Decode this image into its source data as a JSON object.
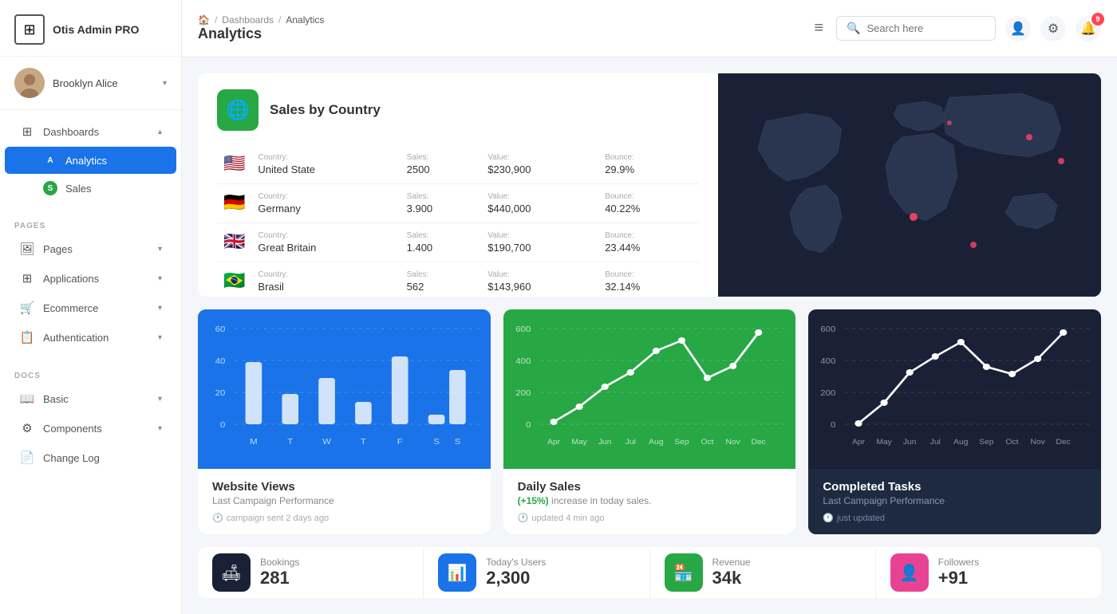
{
  "app": {
    "name": "Otis Admin PRO"
  },
  "user": {
    "name": "Brooklyn Alice"
  },
  "breadcrumb": {
    "home": "🏠",
    "dashboards": "Dashboards",
    "current": "Analytics",
    "page_title": "Analytics"
  },
  "header": {
    "search_placeholder": "Search here",
    "hamburger": "≡",
    "notification_count": "9"
  },
  "sidebar": {
    "nav_sections": [
      {
        "label": "",
        "items": [
          {
            "id": "dashboards",
            "icon": "⊞",
            "label": "Dashboards",
            "active": false,
            "has_chevron": true
          },
          {
            "id": "analytics",
            "icon": "A",
            "label": "Analytics",
            "active": true,
            "is_sub": true
          },
          {
            "id": "sales",
            "icon": "S",
            "label": "Sales",
            "active": false,
            "is_sub": true
          }
        ]
      },
      {
        "label": "PAGES",
        "items": [
          {
            "id": "pages",
            "icon": "🖼",
            "label": "Pages",
            "has_chevron": true
          },
          {
            "id": "applications",
            "icon": "⊞",
            "label": "Applications",
            "has_chevron": true
          },
          {
            "id": "ecommerce",
            "icon": "🛒",
            "label": "Ecommerce",
            "has_chevron": true
          },
          {
            "id": "authentication",
            "icon": "📋",
            "label": "Authentication",
            "has_chevron": true
          }
        ]
      },
      {
        "label": "DOCS",
        "items": [
          {
            "id": "basic",
            "icon": "📖",
            "label": "Basic",
            "has_chevron": true
          },
          {
            "id": "components",
            "icon": "⚙",
            "label": "Components",
            "has_chevron": true
          },
          {
            "id": "changelog",
            "icon": "📄",
            "label": "Change Log"
          }
        ]
      }
    ]
  },
  "sales_by_country": {
    "title": "Sales by Country",
    "rows": [
      {
        "flag": "🇺🇸",
        "country_label": "Country:",
        "country": "United State",
        "sales_label": "Sales:",
        "sales": "2500",
        "value_label": "Value:",
        "value": "$230,900",
        "bounce_label": "Bounce:",
        "bounce": "29.9%"
      },
      {
        "flag": "🇩🇪",
        "country_label": "Country:",
        "country": "Germany",
        "sales_label": "Sales:",
        "sales": "3.900",
        "value_label": "Value:",
        "value": "$440,000",
        "bounce_label": "Bounce:",
        "bounce": "40.22%"
      },
      {
        "flag": "🇬🇧",
        "country_label": "Country:",
        "country": "Great Britain",
        "sales_label": "Sales:",
        "sales": "1.400",
        "value_label": "Value:",
        "value": "$190,700",
        "bounce_label": "Bounce:",
        "bounce": "23.44%"
      },
      {
        "flag": "🇧🇷",
        "country_label": "Country:",
        "country": "Brasil",
        "sales_label": "Sales:",
        "sales": "562",
        "value_label": "Value:",
        "value": "$143,960",
        "bounce_label": "Bounce:",
        "bounce": "32.14%"
      }
    ]
  },
  "charts": {
    "website_views": {
      "title": "Website Views",
      "subtitle": "Last Campaign Performance",
      "footer": "campaign sent 2 days ago",
      "y_labels": [
        "60",
        "40",
        "20",
        "0"
      ],
      "x_labels": [
        "M",
        "T",
        "W",
        "T",
        "F",
        "S",
        "S"
      ],
      "bars": [
        45,
        25,
        35,
        20,
        50,
        10,
        40
      ]
    },
    "daily_sales": {
      "title": "Daily Sales",
      "subtitle_prefix": "(+15%)",
      "subtitle_suffix": " increase in today sales.",
      "footer": "updated 4 min ago",
      "y_labels": [
        "600",
        "400",
        "200",
        "0"
      ],
      "x_labels": [
        "Apr",
        "May",
        "Jun",
        "Jul",
        "Aug",
        "Sep",
        "Oct",
        "Nov",
        "Dec"
      ],
      "points": [
        10,
        80,
        220,
        300,
        420,
        480,
        280,
        350,
        520
      ]
    },
    "completed_tasks": {
      "title": "Completed Tasks",
      "subtitle": "Last Campaign Performance",
      "footer": "just updated",
      "y_labels": [
        "600",
        "400",
        "200",
        "0"
      ],
      "x_labels": [
        "Apr",
        "May",
        "Jun",
        "Jul",
        "Aug",
        "Sep",
        "Oct",
        "Nov",
        "Dec"
      ],
      "points": [
        20,
        120,
        280,
        380,
        460,
        320,
        280,
        360,
        520
      ]
    }
  },
  "stats": [
    {
      "id": "bookings",
      "icon": "🛋",
      "icon_style": "dark",
      "label": "Bookings",
      "value": "281"
    },
    {
      "id": "today-users",
      "icon": "📊",
      "icon_style": "blue",
      "label": "Today's Users",
      "value": "2,300"
    },
    {
      "id": "revenue",
      "icon": "🏪",
      "icon_style": "green",
      "label": "Revenue",
      "value": "34k"
    },
    {
      "id": "followers",
      "icon": "👤",
      "icon_style": "pink",
      "label": "Followers",
      "value": "+91"
    }
  ]
}
